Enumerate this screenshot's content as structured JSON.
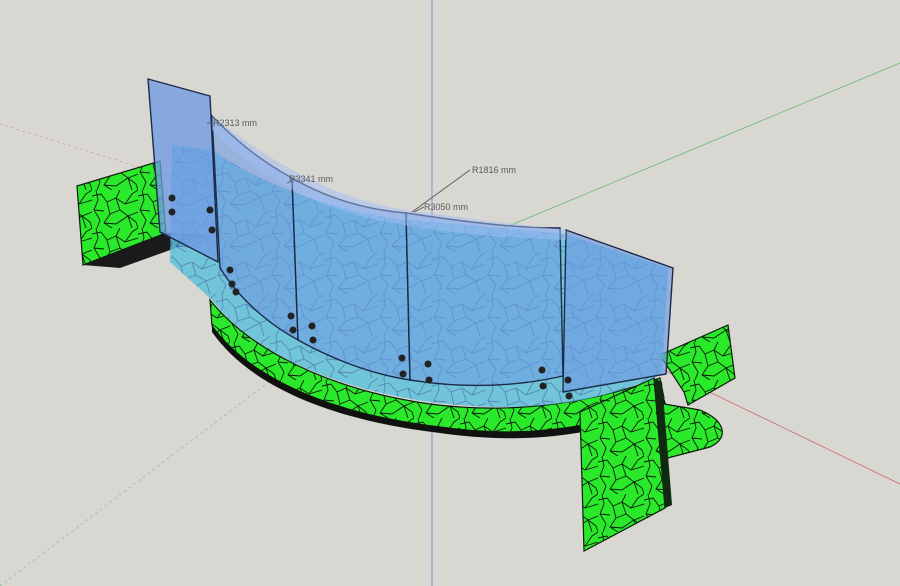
{
  "viewport": {
    "background": "#d8d7d2",
    "axes_colors": {
      "red": "#c66b6b",
      "green": "#6bb86b",
      "blue": "#7c7ccf"
    }
  },
  "model": {
    "steel_color": "#2ae82a",
    "glass_color": "#6f9ae3",
    "glass_inner_color": "#64c4e4"
  },
  "dimensions": [
    {
      "id": "r2313",
      "text": "R2313 mm"
    },
    {
      "id": "r3341",
      "text": "R3341 mm"
    },
    {
      "id": "r1816",
      "text": "R1816 mm"
    },
    {
      "id": "r3050",
      "text": "R3050 mm"
    }
  ]
}
